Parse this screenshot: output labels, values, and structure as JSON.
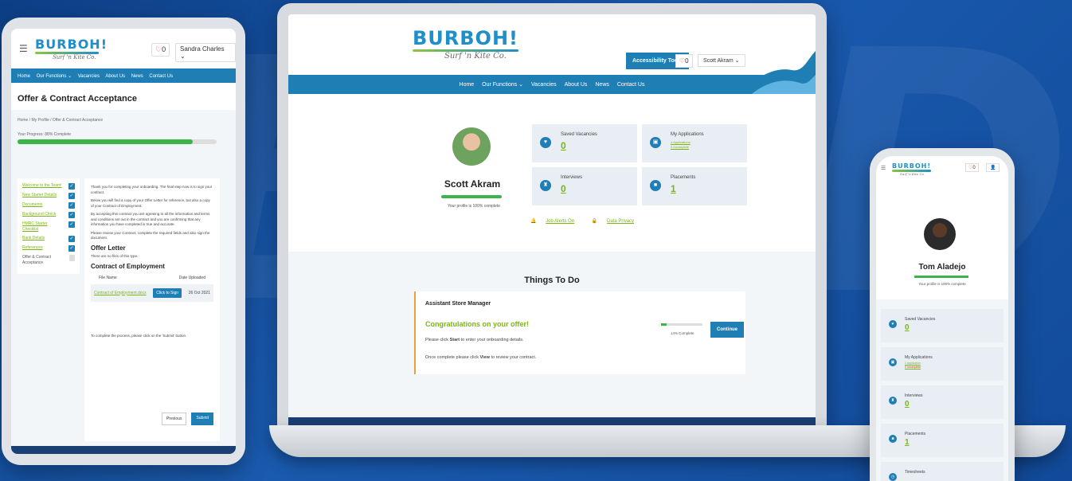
{
  "brand": {
    "logo_word": "BURBOH!",
    "logo_sub": "Surf 'n Kite Co."
  },
  "tablet": {
    "heart_count": "0",
    "user_name": "Sandra Charles",
    "nav": [
      "Home",
      "Our Functions ⌄",
      "Vacancies",
      "About Us",
      "News",
      "Contact Us"
    ],
    "page_title": "Offer & Contract Acceptance",
    "breadcrumb": "Home / My Profile / Offer & Contract Acceptance",
    "progress_label": "Your Progress: 88% Complete",
    "progress_pct": 88,
    "steps": [
      {
        "label": "Welcome to the Team!",
        "done": true
      },
      {
        "label": "New Starter Details",
        "done": true
      },
      {
        "label": "Documents",
        "done": true
      },
      {
        "label": "Background Check",
        "done": true
      },
      {
        "label": "HMRC Starter Checklist",
        "done": true
      },
      {
        "label": "Bank Details",
        "done": true
      },
      {
        "label": "References",
        "done": true
      },
      {
        "label": "Offer & Contract Acceptance",
        "done": false
      }
    ],
    "para1": "Thank you for completing your onboarding. The final step now is to sign your contract.",
    "para2": "Below you will find a copy of your Offer Letter for reference, but also a copy of your Contract of Employment.",
    "para3": "By accepting this contract you are agreeing to all the information and terms and conditions set out in the contract and you are confirming that any information you have completed is true and accurate.",
    "para4": "Please review your Contract, complete the required fields and also sign the document.",
    "offer_heading": "Offer Letter",
    "offer_none": "There are no files of this type.",
    "contract_heading": "Contract of Employment",
    "col_file": "File Name",
    "col_date": "Date Uploaded",
    "file_name": "Contract of Employment.docx",
    "sign_label": "Click to Sign",
    "file_date": "26 Oct 2021",
    "complete_note": "To complete the process, please click on the 'Submit' button.",
    "prev_label": "Previous",
    "submit_label": "Submit"
  },
  "laptop": {
    "access_label": "Accessibility Tools",
    "heart_count": "0",
    "user_name": "Scott Akram",
    "nav": [
      "Home",
      "Our Functions ⌄",
      "Vacancies",
      "About Us",
      "News",
      "Contact Us"
    ],
    "profile_name": "Scott Akram",
    "profile_done": "Your profile is 100% complete",
    "cards": {
      "saved_label": "Saved Vacancies",
      "saved_value": "0",
      "apps_label": "My Applications",
      "apps_sub1": "4 Applications",
      "apps_sub2": "0 Incomplete",
      "interviews_label": "Interviews",
      "interviews_value": "0",
      "placements_label": "Placements",
      "placements_value": "1"
    },
    "job_alerts": "Job Alerts On",
    "data_privacy": "Data Privacy",
    "todo_title": "Things To Do",
    "todo_job": "Assistant Store Manager",
    "todo_congrats": "Congratulations on your offer!",
    "todo_p1_a": "Please click ",
    "todo_p1_b": "Start",
    "todo_p1_c": " to enter your onboarding details.",
    "todo_p2_a": "Once complete please click ",
    "todo_p2_b": "View",
    "todo_p2_c": " to review your contract.",
    "todo_pct_label": "14% Complete",
    "todo_pct": 14,
    "continue_label": "Continue"
  },
  "phone": {
    "heart_count": "0",
    "profile_name": "Tom Aladejo",
    "profile_done": "Your profile is 100% complete",
    "saved_label": "Saved Vacancies",
    "saved_value": "0",
    "apps_label": "My Applications",
    "apps_sub1": "1 Application",
    "apps_sub2": "0 Incomplete",
    "interviews_label": "Interviews",
    "interviews_value": "0",
    "placements_label": "Placements",
    "placements_value": "1",
    "timesheets_label": "Timesheets"
  },
  "colors": {
    "primary": "#1f7fb5",
    "accent_green": "#7cb518",
    "progress_green": "#3bb54a",
    "heart": "#c0392b",
    "bg_blue": "#124a99"
  }
}
